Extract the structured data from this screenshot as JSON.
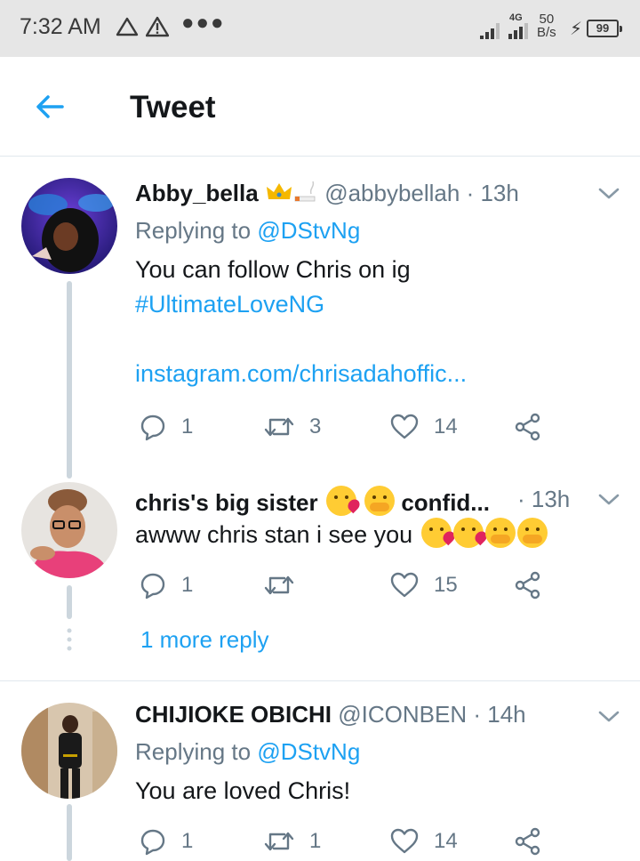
{
  "status_bar": {
    "time": "7:32 AM",
    "network": "4G",
    "speed_value": "50",
    "speed_unit": "B/s",
    "battery": "99"
  },
  "header": {
    "title": "Tweet"
  },
  "tweets": [
    {
      "name": "Abby_bella",
      "name_emoji": "👑🚬",
      "handle": "@abbybellah",
      "time": "· 13h",
      "replying_prefix": "Replying to ",
      "replying_to": "@DStvNg",
      "text": "You can follow Chris on ig",
      "hashtag": "#UltimateLoveNG",
      "link": "instagram.com/chrisadahoffic...",
      "replies": "1",
      "retweets": "3",
      "likes": "14"
    },
    {
      "name": "chris's big sister",
      "name_suffix": "confid...",
      "time": "· 13h",
      "text": "awww chris stan i see you",
      "replies": "1",
      "retweets": "",
      "likes": "15"
    },
    {
      "name": "CHIJIOKE OBICHI",
      "handle": "@ICONBEN",
      "time": "· 14h",
      "replying_prefix": "Replying to ",
      "replying_to": "@DStvNg",
      "text": "You are loved Chris!",
      "replies": "1",
      "retweets": "1",
      "likes": "14"
    }
  ],
  "more_reply": "1 more reply",
  "colors": {
    "accent": "#1da1f2",
    "secondary_text": "#657786",
    "primary_text": "#14171a",
    "thread_line": "#ccd6dd",
    "status_bar_bg": "#e6e6e6"
  },
  "icons": {
    "back": "arrow-left-icon",
    "reply": "reply-bubble-icon",
    "retweet": "retweet-icon",
    "like": "heart-icon",
    "share": "share-icon",
    "more": "chevron-down-icon"
  }
}
